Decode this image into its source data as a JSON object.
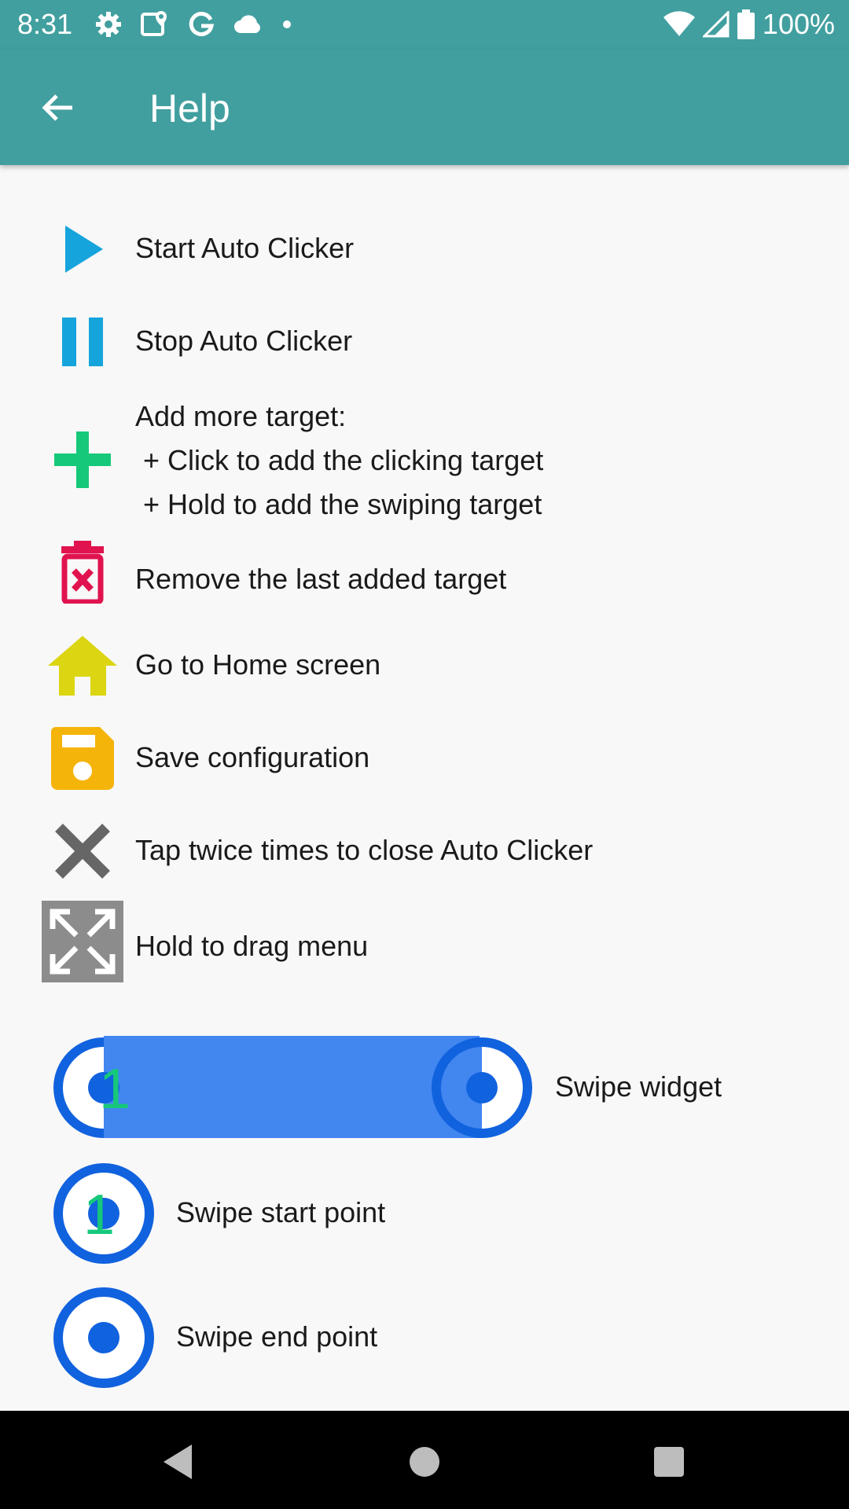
{
  "status_bar": {
    "time": "8:31",
    "battery": "100%",
    "left_icons": [
      "settings-icon",
      "maps-icon",
      "google-icon",
      "cloud-icon",
      "dot-icon"
    ],
    "right_icons": [
      "wifi-icon",
      "signal-icon",
      "battery-icon"
    ]
  },
  "app_bar": {
    "title": "Help",
    "back_icon": "arrow-back-icon"
  },
  "help_items": [
    {
      "icon": "play-icon",
      "lines": [
        "Start Auto Clicker"
      ]
    },
    {
      "icon": "pause-icon",
      "lines": [
        "Stop Auto Clicker"
      ]
    },
    {
      "icon": "plus-icon",
      "lines": [
        "Add more target:",
        " + Click to add the clicking target",
        " + Hold to add the swiping target"
      ]
    },
    {
      "icon": "trash-icon",
      "lines": [
        "Remove the last added target"
      ]
    },
    {
      "icon": "home-icon",
      "lines": [
        "Go to Home screen"
      ]
    },
    {
      "icon": "save-icon",
      "lines": [
        "Save configuration"
      ]
    },
    {
      "icon": "close-icon",
      "lines": [
        "Tap twice times to close Auto Clicker"
      ]
    },
    {
      "icon": "drag-icon",
      "lines": [
        "Hold to drag menu"
      ]
    }
  ],
  "swipe_items": {
    "widget_label": "Swipe widget",
    "start_label": "Swipe start point",
    "end_label": "Swipe end point",
    "start_number": "1"
  },
  "colors": {
    "app_bar": "#429f9f",
    "play": "#15a4dc",
    "plus": "#16c97a",
    "trash": "#e0134f",
    "home": "#dbd512",
    "save": "#f5b40a",
    "close": "#666666",
    "drag": "#8c8c8c",
    "swipe_blue": "#1162de",
    "swipe_bar": "#4286f0"
  },
  "nav_bar": {
    "icons": [
      "back-triangle-icon",
      "home-circle-icon",
      "recents-square-icon"
    ]
  }
}
